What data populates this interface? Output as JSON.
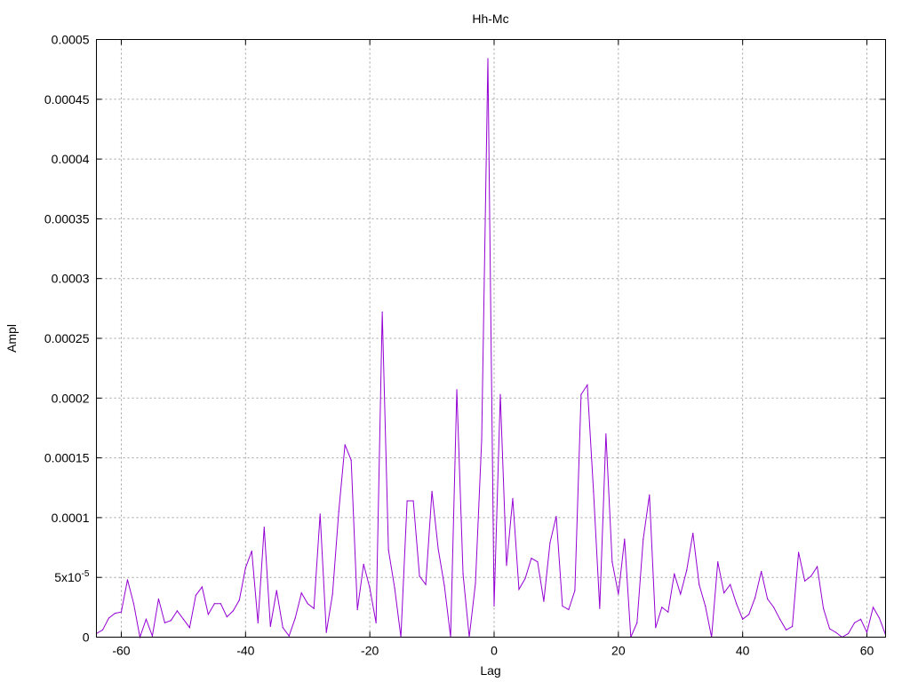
{
  "chart_data": {
    "type": "line",
    "title": "Hh-Mc",
    "xlabel": "Lag",
    "ylabel": "Ampl",
    "xlim": [
      -64,
      63
    ],
    "ylim": [
      0,
      0.0005
    ],
    "grid": true,
    "line_color": "#9400d3",
    "x_ticks": [
      {
        "value": -60,
        "label": "-60"
      },
      {
        "value": -40,
        "label": "-40"
      },
      {
        "value": -20,
        "label": "-20"
      },
      {
        "value": 0,
        "label": "0"
      },
      {
        "value": 20,
        "label": "20"
      },
      {
        "value": 40,
        "label": "40"
      },
      {
        "value": 60,
        "label": "60"
      }
    ],
    "y_ticks": [
      {
        "value": 0,
        "label": "0"
      },
      {
        "value": 5e-05,
        "label": "5x10",
        "sup": "-5"
      },
      {
        "value": 0.0001,
        "label": "0.0001"
      },
      {
        "value": 0.00015,
        "label": "0.00015"
      },
      {
        "value": 0.0002,
        "label": "0.0002"
      },
      {
        "value": 0.00025,
        "label": "0.00025"
      },
      {
        "value": 0.0003,
        "label": "0.0003"
      },
      {
        "value": 0.00035,
        "label": "0.00035"
      },
      {
        "value": 0.0004,
        "label": "0.0004"
      },
      {
        "value": 0.00045,
        "label": "0.00045"
      },
      {
        "value": 0.0005,
        "label": "0.0005"
      }
    ],
    "series": [
      {
        "x": [
          -64,
          -63,
          -62,
          -61,
          -60,
          -59,
          -58,
          -57,
          -56,
          -55,
          -54,
          -53,
          -52,
          -51,
          -50,
          -49,
          -48,
          -47,
          -46,
          -45,
          -44,
          -43,
          -42,
          -41,
          -40,
          -39,
          -38,
          -37,
          -36,
          -35,
          -34,
          -33,
          -32,
          -31,
          -30,
          -29,
          -28,
          -27,
          -26,
          -25,
          -24,
          -23,
          -22,
          -21,
          -20,
          -19,
          -18,
          -17,
          -16,
          -15,
          -14,
          -13,
          -12,
          -11,
          -10,
          -9,
          -8,
          -7,
          -6,
          -5,
          -4,
          -3,
          -2,
          -1,
          0,
          1,
          2,
          3,
          4,
          5,
          6,
          7,
          8,
          9,
          10,
          11,
          12,
          13,
          14,
          15,
          16,
          17,
          18,
          19,
          20,
          21,
          22,
          23,
          24,
          25,
          26,
          27,
          28,
          29,
          30,
          31,
          32,
          33,
          34,
          35,
          36,
          37,
          38,
          39,
          40,
          41,
          42,
          43,
          44,
          45,
          46,
          47,
          48,
          49,
          50,
          51,
          52,
          53,
          54,
          55,
          56,
          57,
          58,
          59,
          60,
          61,
          62,
          63
        ],
        "values": [
          3e-06,
          6e-06,
          1.6e-05,
          2e-05,
          2.1e-05,
          4.8e-05,
          2.8e-05,
          0.0,
          1.5e-05,
          1e-06,
          3.2e-05,
          1.2e-05,
          1.4e-05,
          2.2e-05,
          1.5e-05,
          8e-06,
          3.5e-05,
          4.2e-05,
          1.9e-05,
          2.8e-05,
          2.8e-05,
          1.7e-05,
          2.2e-05,
          3.1e-05,
          5.8e-05,
          7.2e-05,
          1.2e-05,
          9.2e-05,
          9e-06,
          3.9e-05,
          8e-06,
          1e-06,
          1.6e-05,
          3.7e-05,
          2.8e-05,
          2.4e-05,
          0.000103,
          4e-06,
          3.6e-05,
          0.000105,
          0.000161,
          0.000148,
          2.3e-05,
          6.1e-05,
          4.1e-05,
          1.2e-05,
          0.000272,
          7.3e-05,
          4.1e-05,
          0.0,
          0.000114,
          0.000114,
          5.1e-05,
          4.4e-05,
          0.000122,
          7.4e-05,
          4.3e-05,
          0.0,
          0.000207,
          5.3e-05,
          0.0,
          4.5e-05,
          0.000165,
          0.000484,
          2.6e-05,
          0.000203,
          6e-05,
          0.000116,
          4e-05,
          4.9e-05,
          6.6e-05,
          6.3e-05,
          3e-05,
          7.9e-05,
          0.000101,
          2.6e-05,
          2.3e-05,
          3.9e-05,
          0.000203,
          0.000211,
          0.000122,
          2.4e-05,
          0.00017,
          6.3e-05,
          3.6e-05,
          8.2e-05,
          0.0,
          1.2e-05,
          8.2e-05,
          0.000119,
          8e-06,
          2.5e-05,
          2.1e-05,
          5.3e-05,
          3.6e-05,
          5.6e-05,
          8.7e-05,
          4.4e-05,
          2.6e-05,
          0.0,
          6.3e-05,
          3.7e-05,
          4.4e-05,
          2.8e-05,
          1.5e-05,
          1.9e-05,
          3.3e-05,
          5.5e-05,
          3.2e-05,
          2.5e-05,
          1.5e-05,
          6e-06,
          9e-06,
          7.1e-05,
          4.7e-05,
          5.1e-05,
          5.9e-05,
          2.4e-05,
          7e-06,
          4e-06,
          0.0,
          3e-06,
          1.2e-05,
          1.5e-05,
          4e-06,
          2.5e-05,
          1.6e-05,
          2e-06
        ]
      }
    ]
  }
}
